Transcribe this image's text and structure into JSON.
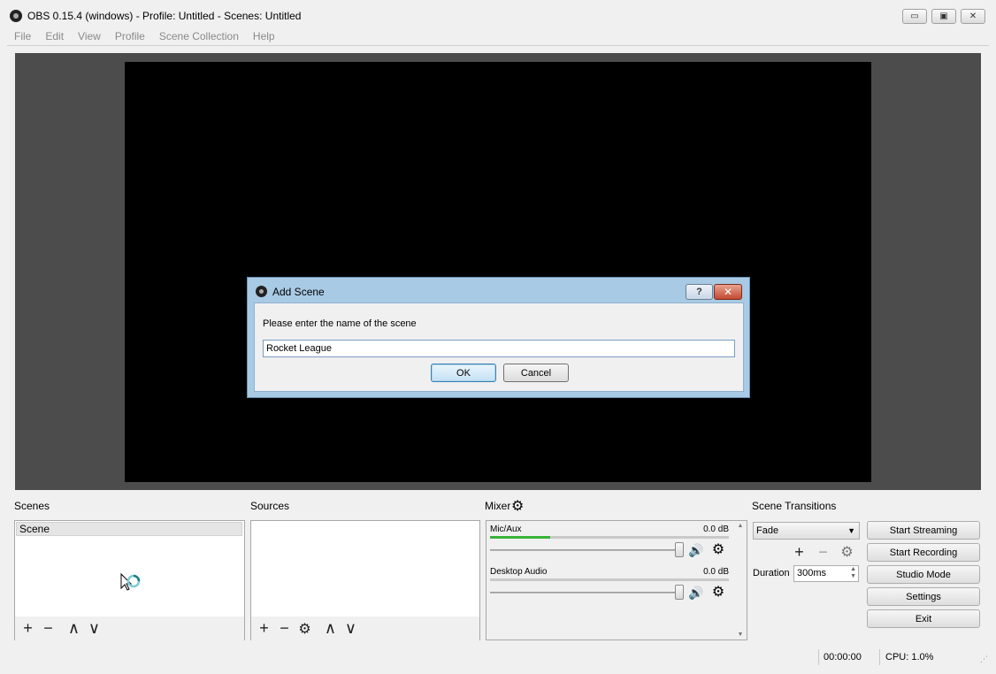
{
  "window": {
    "title": "OBS 0.15.4 (windows) - Profile: Untitled - Scenes: Untitled",
    "minimize_glyph": "▭",
    "maximize_glyph": "▣",
    "close_glyph": "✕"
  },
  "menubar": {
    "items": [
      "File",
      "Edit",
      "View",
      "Profile",
      "Scene Collection",
      "Help"
    ]
  },
  "dialog": {
    "title": "Add Scene",
    "help_glyph": "?",
    "close_glyph": "✕",
    "prompt": "Please enter the name of the scene",
    "input_value": "Rocket League",
    "ok_label": "OK",
    "cancel_label": "Cancel"
  },
  "scenes": {
    "label": "Scenes",
    "items": [
      "Scene"
    ]
  },
  "sources": {
    "label": "Sources"
  },
  "mixer": {
    "label": "Mixer",
    "channels": [
      {
        "name": "Mic/Aux",
        "db": "0.0 dB",
        "meter_level": 0.25
      },
      {
        "name": "Desktop Audio",
        "db": "0.0 dB",
        "meter_level": 0.0
      }
    ]
  },
  "transitions": {
    "label": "Scene Transitions",
    "selected": "Fade",
    "duration_label": "Duration",
    "duration_value": "300ms"
  },
  "controls": {
    "start_streaming": "Start Streaming",
    "start_recording": "Start Recording",
    "studio_mode": "Studio Mode",
    "settings": "Settings",
    "exit": "Exit"
  },
  "status": {
    "time": "00:00:00",
    "cpu": "CPU: 1.0%"
  },
  "toolbar_glyphs": {
    "add": "+",
    "remove": "−",
    "up": "∧",
    "down": "∨",
    "gear": "⚙",
    "speaker": "🔊"
  },
  "colors": {
    "preview_bg": "#4c4c4c",
    "canvas": "#000000",
    "meter_green": "#3ab33a",
    "dialog_frame": "#a8cae4"
  }
}
